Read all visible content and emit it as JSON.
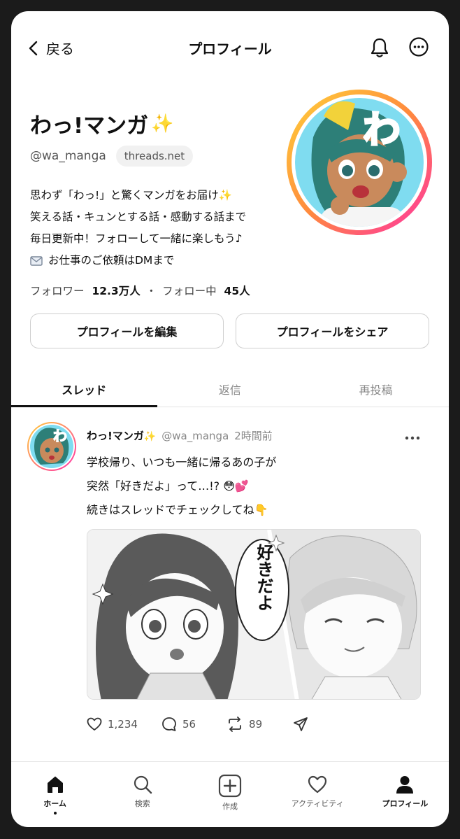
{
  "header": {
    "back_label": "戻る",
    "title": "プロフィール"
  },
  "profile": {
    "name": "わっ!マンガ",
    "name_emoji": "✨",
    "handle": "@wa_manga",
    "domain_chip": "threads.net",
    "avatar_letter": "わ",
    "bio_lines": [
      "思わず「わっ!」と驚くマンガをお届け✨",
      "笑える話・キュンとする話・感動する話まで",
      "毎日更新中！フォローして一緒に楽しもう♪",
      "お仕事のご依頼はDMまで"
    ],
    "followers_label": "フォロワー",
    "followers_count": "12.3万人",
    "separator": "・",
    "following_label": "フォロー中",
    "following_count": "45人"
  },
  "buttons": {
    "edit": "プロフィールを編集",
    "share": "プロフィールをシェア"
  },
  "tabs": [
    {
      "label": "スレッド",
      "active": true
    },
    {
      "label": "返信",
      "active": false
    },
    {
      "label": "再投稿",
      "active": false
    }
  ],
  "post": {
    "name": "わっ!マンガ",
    "name_emoji": "✨",
    "handle": "@wa_manga",
    "time": "2時間前",
    "lines": [
      "学校帰り、いつも一緒に帰るあの子が",
      "突然「好きだよ」って…!? 😳💕",
      "続きはスレッドでチェックしてね👇"
    ],
    "image_speech": "好きだよ",
    "likes": "1,234",
    "replies": "56",
    "reposts": "89"
  },
  "bottom_nav": [
    {
      "label": "ホーム",
      "icon": "home-icon",
      "active": true
    },
    {
      "label": "検索",
      "icon": "search-icon",
      "active": false
    },
    {
      "label": "作成",
      "icon": "create-icon",
      "active": false
    },
    {
      "label": "アクティビティ",
      "icon": "heart-icon",
      "active": false
    },
    {
      "label": "プロフィール",
      "icon": "person-icon",
      "active": true
    }
  ],
  "colors": {
    "accent_sparkle": "#f5b800",
    "avatar_ring_start": "#ffcc33",
    "avatar_ring_end": "#ff3da0",
    "avatar_letter": "#ff3d8b",
    "hair": "#2d7f78"
  }
}
